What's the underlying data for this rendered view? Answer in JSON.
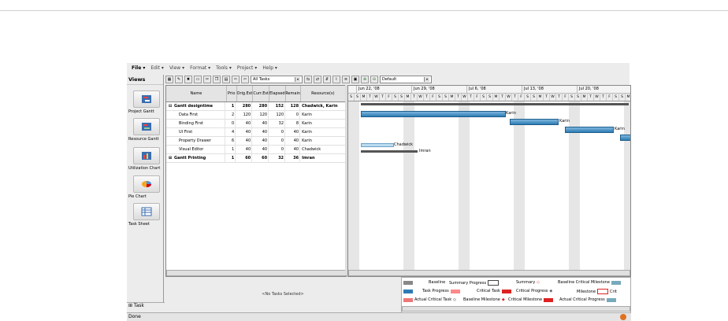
{
  "menu": [
    "File ▾",
    "Edit ▾",
    "View ▾",
    "Format ▾",
    "Tools ▾",
    "Project ▾",
    "Help ▾"
  ],
  "views": {
    "header": "Views",
    "items": [
      {
        "label": "Project Gantt",
        "icon": "project-gantt-icon"
      },
      {
        "label": "Resource Gantt",
        "icon": "resource-gantt-icon"
      },
      {
        "label": "Utilization Chart",
        "icon": "utilization-chart-icon"
      },
      {
        "label": "Pie Chart",
        "icon": "pie-chart-icon"
      },
      {
        "label": "Task Sheet",
        "icon": "task-sheet-icon"
      }
    ]
  },
  "toolbar": {
    "filter_value": "All Tasks",
    "view_value": "Default"
  },
  "grid": {
    "columns": [
      "Name",
      "Prio",
      "Orig.Est",
      "Curr.Est",
      "Elapsed",
      "Remain",
      "Resource(s)"
    ],
    "rows": [
      {
        "toggle": "⊟",
        "name": "Gantt designtime",
        "prio": "1",
        "orig": "280",
        "curr": "280",
        "elapsed": "152",
        "remain": "128",
        "res": "Chadwick, Karin",
        "bold": true
      },
      {
        "toggle": "",
        "name": "Data First",
        "prio": "2",
        "orig": "120",
        "curr": "120",
        "elapsed": "120",
        "remain": "0",
        "res": "Karin",
        "bold": false
      },
      {
        "toggle": "",
        "name": "Binding First",
        "prio": "0",
        "orig": "40",
        "curr": "40",
        "elapsed": "32",
        "remain": "8",
        "res": "Karin",
        "bold": false
      },
      {
        "toggle": "",
        "name": "UI First",
        "prio": "4",
        "orig": "40",
        "curr": "40",
        "elapsed": "0",
        "remain": "40",
        "res": "Karin",
        "bold": false
      },
      {
        "toggle": "",
        "name": "Property Drawer",
        "prio": "6",
        "orig": "40",
        "curr": "40",
        "elapsed": "0",
        "remain": "40",
        "res": "Karin",
        "bold": false
      },
      {
        "toggle": "",
        "name": "Visual Editor",
        "prio": "1",
        "orig": "40",
        "curr": "40",
        "elapsed": "0",
        "remain": "40",
        "res": "Chadwick",
        "bold": false
      },
      {
        "toggle": "⊞",
        "name": "Gantt Printing",
        "prio": "1",
        "orig": "60",
        "curr": "60",
        "elapsed": "32",
        "remain": "36",
        "res": "Imran",
        "bold": true
      }
    ]
  },
  "gantt": {
    "weeks": [
      "Jun 22, '08",
      "Jun 29, '08",
      "Jul 6, '08",
      "Jul 13, '08",
      "Jul 20, '08"
    ],
    "day_letters": [
      "S",
      "S",
      "M",
      "T",
      "W",
      "T",
      "F"
    ],
    "bar_labels": [
      "Karin",
      "Karin",
      "Karin",
      "Chadwick",
      "Imran"
    ]
  },
  "detail": {
    "empty_text": "<No Tasks Selected>"
  },
  "legend": [
    "Baseline",
    "Summary Progress",
    "Summary",
    "Baseline Critical Milestone",
    "Task Progress",
    "Critical Task",
    "Critical Progress",
    "Milestone",
    "Actual Critical Task",
    "Baseline Milestone",
    "Critical Milestone",
    "Actual Critical Progress",
    "Crit"
  ],
  "task_tab": "⊞ Task",
  "status": "Done"
}
